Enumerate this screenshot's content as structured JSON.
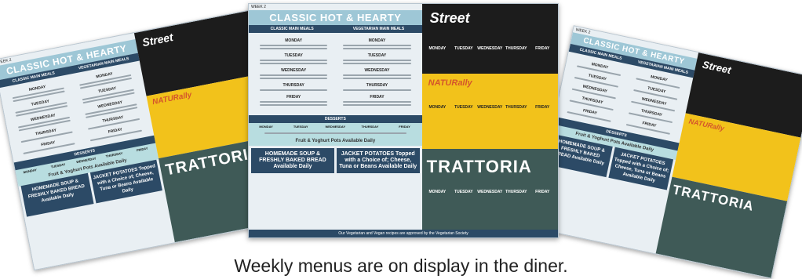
{
  "caption": "Weekly menus are on display in the diner.",
  "menu": {
    "week_label": "WEEK 2",
    "title": "CLASSIC HOT & HEARTY",
    "classic_label": "CLASSIC MAIN MEALS",
    "veg_label": "VEGETARIAN MAIN MEALS",
    "days": [
      "MONDAY",
      "TUESDAY",
      "WEDNESDAY",
      "THURSDAY",
      "FRIDAY"
    ],
    "desserts_label": "DESSERTS",
    "fruit_text": "Fruit & Yoghurt Pots Available Daily",
    "soup_text": "HOMEMADE SOUP & FRESHLY BAKED BREAD Available Daily",
    "jacket_text": "JACKET POTATOES Topped with a Choice of; Cheese, Tuna or Beans Available Daily",
    "trattoria_label": "TRATTORIA",
    "naturally_label": "NATURally",
    "footer_text": "Our Vegetarian and Vegan recipes are approved by the Vegetarian Society"
  }
}
